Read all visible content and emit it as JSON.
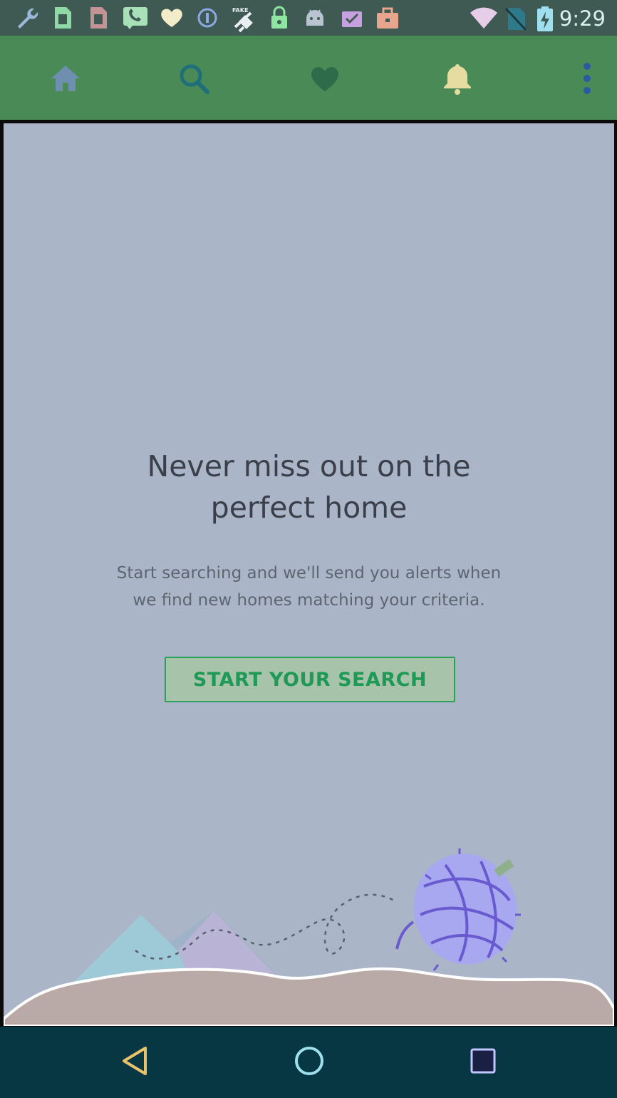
{
  "status_bar": {
    "time": "9:29",
    "left_icons": [
      "wrench-icon",
      "sim-icon",
      "sim-alt-icon",
      "phone-icon",
      "heart-icon",
      "info-icon",
      "fake-gps-icon",
      "lock-icon",
      "android-icon",
      "checklist-icon",
      "briefcase-icon"
    ],
    "right_icons": [
      "wifi-icon",
      "no-sim-icon",
      "battery-charging-icon"
    ]
  },
  "app_bar": {
    "items": [
      "home-icon",
      "search-icon",
      "favorites-icon",
      "notifications-icon",
      "overflow-menu-icon"
    ]
  },
  "empty_state": {
    "headline_line1": "Never miss out on the",
    "headline_line2": "perfect home",
    "body_line1": "Start searching and we'll send you alerts when",
    "body_line2": "we find new homes matching your criteria.",
    "cta_label": "START YOUR SEARCH"
  },
  "system_nav": {
    "items": [
      "back-icon",
      "home-circle-icon",
      "recents-icon"
    ]
  },
  "colors": {
    "status_bar": "#3f5a52",
    "app_bar": "#4a8a56",
    "content_bg": "#aab5c8",
    "cta_text": "#1e9a56",
    "system_nav": "#083744"
  }
}
